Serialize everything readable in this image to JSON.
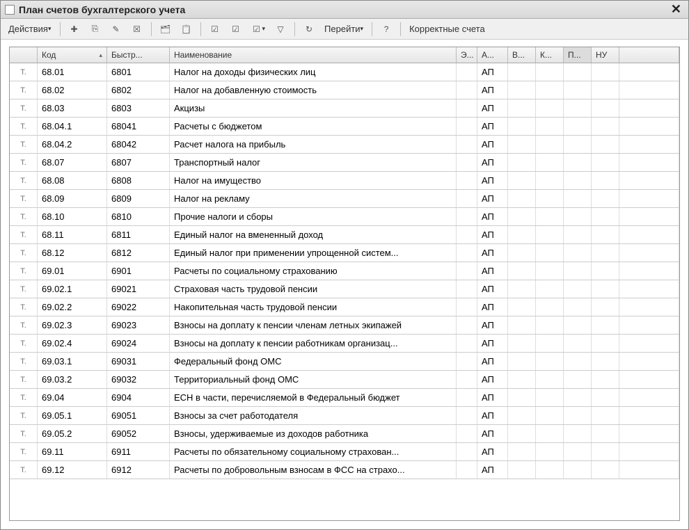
{
  "window": {
    "title": "План счетов бухгалтерского учета"
  },
  "toolbar": {
    "actions": "Действия",
    "go": "Перейти",
    "correct": "Корректные счета"
  },
  "columns": {
    "icon": "",
    "kod": "Код",
    "bystr": "Быстр...",
    "name": "Наименование",
    "e": "Э...",
    "a": "А...",
    "v": "В...",
    "k": "К...",
    "p": "П...",
    "nu": "НУ"
  },
  "row_icon": "Т.",
  "rows": [
    {
      "kod": "68.01",
      "bystr": "6801",
      "name": "Налог на доходы физических лиц",
      "a": "АП"
    },
    {
      "kod": "68.02",
      "bystr": "6802",
      "name": "Налог на добавленную стоимость",
      "a": "АП"
    },
    {
      "kod": "68.03",
      "bystr": "6803",
      "name": "Акцизы",
      "a": "АП"
    },
    {
      "kod": "68.04.1",
      "bystr": "68041",
      "name": "Расчеты с бюджетом",
      "a": "АП"
    },
    {
      "kod": "68.04.2",
      "bystr": "68042",
      "name": "Расчет налога на прибыль",
      "a": "АП"
    },
    {
      "kod": "68.07",
      "bystr": "6807",
      "name": "Транспортный налог",
      "a": "АП"
    },
    {
      "kod": "68.08",
      "bystr": "6808",
      "name": "Налог на имущество",
      "a": "АП"
    },
    {
      "kod": "68.09",
      "bystr": "6809",
      "name": "Налог на рекламу",
      "a": "АП"
    },
    {
      "kod": "68.10",
      "bystr": "6810",
      "name": "Прочие налоги и сборы",
      "a": "АП"
    },
    {
      "kod": "68.11",
      "bystr": "6811",
      "name": "Единый налог на вмененный доход",
      "a": "АП"
    },
    {
      "kod": "68.12",
      "bystr": "6812",
      "name": "Единый налог при применении упрощенной систем...",
      "a": "АП"
    },
    {
      "kod": "69.01",
      "bystr": "6901",
      "name": "Расчеты по социальному страхованию",
      "a": "АП"
    },
    {
      "kod": "69.02.1",
      "bystr": "69021",
      "name": "Страховая часть трудовой пенсии",
      "a": "АП"
    },
    {
      "kod": "69.02.2",
      "bystr": "69022",
      "name": "Накопительная часть трудовой пенсии",
      "a": "АП"
    },
    {
      "kod": "69.02.3",
      "bystr": "69023",
      "name": "Взносы на доплату к пенсии членам летных экипажей",
      "a": "АП"
    },
    {
      "kod": "69.02.4",
      "bystr": "69024",
      "name": "Взносы на доплату к пенсии работникам организац...",
      "a": "АП"
    },
    {
      "kod": "69.03.1",
      "bystr": "69031",
      "name": "Федеральный фонд ОМС",
      "a": "АП"
    },
    {
      "kod": "69.03.2",
      "bystr": "69032",
      "name": "Территориальный фонд ОМС",
      "a": "АП"
    },
    {
      "kod": "69.04",
      "bystr": "6904",
      "name": "ЕСН в части, перечисляемой в Федеральный бюджет",
      "a": "АП"
    },
    {
      "kod": "69.05.1",
      "bystr": "69051",
      "name": "Взносы за счет работодателя",
      "a": "АП"
    },
    {
      "kod": "69.05.2",
      "bystr": "69052",
      "name": "Взносы, удерживаемые из доходов работника",
      "a": "АП"
    },
    {
      "kod": "69.11",
      "bystr": "6911",
      "name": "Расчеты по обязательному социальному страхован...",
      "a": "АП"
    },
    {
      "kod": "69.12",
      "bystr": "6912",
      "name": "Расчеты по добровольным взносам в ФСС на страхо...",
      "a": "АП"
    }
  ]
}
